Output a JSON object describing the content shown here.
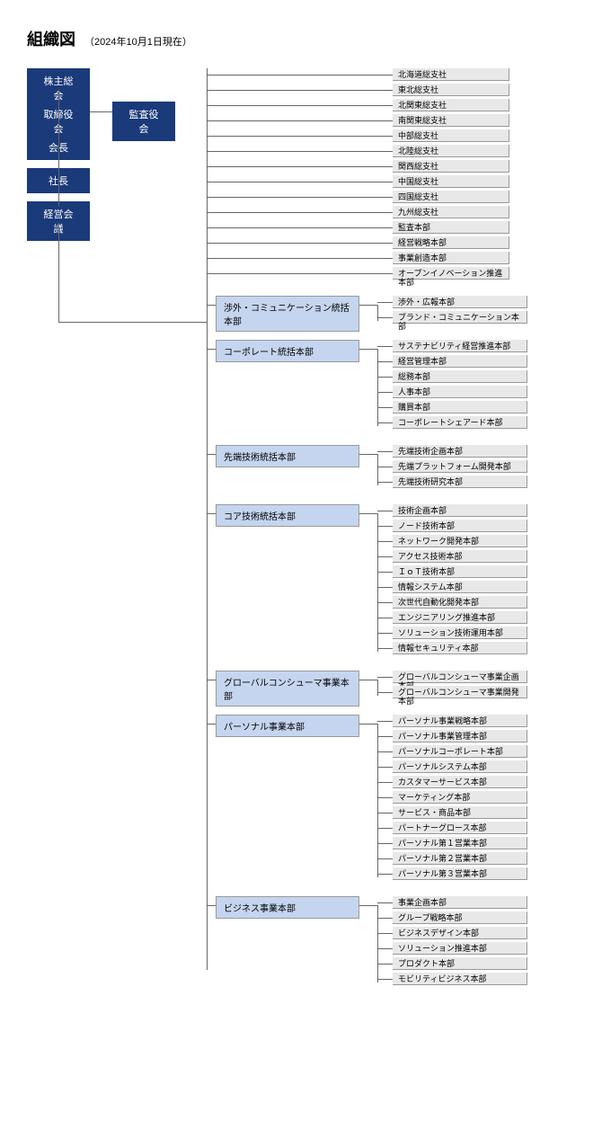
{
  "title": "組織図",
  "date": "（2024年10月1日現在）",
  "navy": {
    "kabunushi": "株主総会",
    "torishimari": "取締役会",
    "kansa": "監査役会",
    "kaicho": "会長",
    "shacho": "社長",
    "keiei": "経営会議"
  },
  "headquarters": {
    "hq1": "渉外・コミュニケーション統括本部",
    "hq2": "コーポレート統括本部",
    "hq3": "先端技術統括本部",
    "hq4": "コア技術統括本部",
    "hq5": "グローバルコンシューマ事業本部",
    "hq6": "パーソナル事業本部",
    "hq7": "ビジネス事業本部"
  },
  "depts": {
    "branches": [
      "北海道総支社",
      "東北総支社",
      "北関東総支社",
      "南関東総支社",
      "中部総支社",
      "北陸総支社",
      "関西総支社",
      "中国総支社",
      "四国総支社",
      "九州総支社",
      "監査本部",
      "経営戦略本部",
      "事業創造本部",
      "オープンイノベーション推進本部"
    ],
    "hq1": [
      "渉外・広報本部",
      "ブランド・コミュニケーション本部"
    ],
    "hq2": [
      "サステナビリティ経営推進本部",
      "経営管理本部",
      "総務本部",
      "人事本部",
      "購買本部",
      "コーポレートシェアード本部"
    ],
    "hq3": [
      "先端技術企画本部",
      "先端プラットフォーム開発本部",
      "先端技術研究本部"
    ],
    "hq4": [
      "技術企画本部",
      "ノード技術本部",
      "ネットワーク開発本部",
      "アクセス技術本部",
      "ＩｏＴ技術本部",
      "情報システム本部",
      "次世代自動化開発本部",
      "エンジニアリング推進本部",
      "ソリューション技術運用本部",
      "情報セキュリティ本部"
    ],
    "hq5": [
      "グローバルコンシューマ事業企画本部",
      "グローバルコンシューマ事業開発本部"
    ],
    "hq6": [
      "パーソナル事業戦略本部",
      "パーソナル事業管理本部",
      "パーソナルコーポレート本部",
      "パーソナルシステム本部",
      "カスタマーサービス本部",
      "マーケティング本部",
      "サービス・商品本部",
      "パートナーグロース本部",
      "パーソナル第１営業本部",
      "パーソナル第２営業本部",
      "パーソナル第３営業本部"
    ],
    "hq7": [
      "事業企画本部",
      "グループ戦略本部",
      "ビジネスデザイン本部",
      "ソリューション推進本部",
      "プロダクト本部",
      "モビリティビジネス本部"
    ]
  }
}
